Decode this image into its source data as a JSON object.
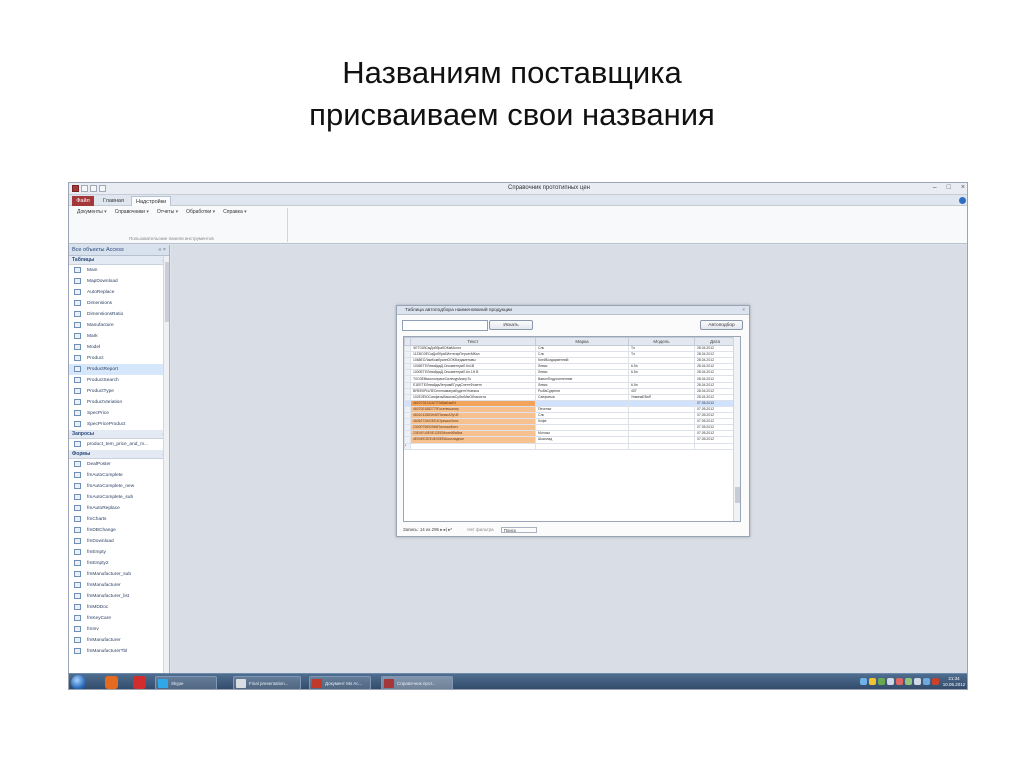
{
  "slide": {
    "title_line1": "Названиям поставщика",
    "title_line2": "присваиваем свои названия"
  },
  "window": {
    "title": "Справочник прототипных цен"
  },
  "ribbon": {
    "tabs": [
      "Файл",
      "Главная",
      "Надстройки"
    ],
    "menus": [
      "Документы",
      "Справочники",
      "Отчеты",
      "Обработки",
      "Справка"
    ],
    "group_label": "Пользовательские панели инструментов"
  },
  "nav": {
    "header": "Все объекты Access",
    "tables_header": "Таблицы",
    "tables": [
      "Main",
      "MapDownload",
      "AutoReplace",
      "Dimensions",
      "DimensionsRatio",
      "Manufacture",
      "Mark",
      "Model",
      "Product",
      "ProductReport",
      "ProductSearch",
      "ProductType",
      "ProductVariation",
      "SpecPrice",
      "SpecPriceProduct"
    ],
    "queries_header": "Запросы",
    "queries": [
      "product_tem_price_and_m..."
    ],
    "forms_header": "Формы",
    "forms": [
      "DealPoster",
      "fmAutoComplete",
      "fmAutoComplete_new",
      "fmAutoComplete_sub",
      "fmAutoReplace",
      "fmCharts",
      "fmDBChange",
      "fmDownload",
      "fmEmpty",
      "fmEmpty2",
      "fmManufacturer_sub",
      "fmManufacturer",
      "fmManufacturer_list",
      "fmMDDoc",
      "fmKeyCare",
      "fmInv",
      "fmManufacturer",
      "fmManufacturerTbl"
    ]
  },
  "form": {
    "title": "Таблица автоподбора наименований продукции",
    "find_button": "Искать",
    "autoselect_button": "Автоподбор",
    "columns": [
      "Текст",
      "Марка",
      "Модель",
      "Дата"
    ],
    "rows": [
      {
        "text": "ЧЕТ01ВСмДоббрабОКмМолот",
        "mark": "Слк",
        "model": "Тл",
        "date": "28.04.2012"
      },
      {
        "text": "1123ЮЗЕСмДоббраБИнтегарПерсатМКал",
        "mark": "Слк",
        "model": "Тл",
        "date": "28.04.2012"
      },
      {
        "text": "1068ЕОЛамКомбраннООКбогдаменовы",
        "mark": "КлейБогдарменний",
        "model": "",
        "date": "28.04.2012"
      },
      {
        "text": "1006ЕТЕЛевайдаД.ОнсаветнумЛ.6л1В",
        "mark": "Левис",
        "model": "6.5н",
        "date": "28.04.2012"
      },
      {
        "text": "1000ЕТЕЛевайдаД.ОнсаветнумЛ.6л.1Н.В",
        "mark": "Левис",
        "model": "6.5н",
        "date": "28.04.2012"
      },
      {
        "text": "Т0ОЗЕВмоснопрасеСилекурАнигрТо",
        "mark": "ВаволПодусопленние",
        "model": "",
        "date": "28.04.2012"
      },
      {
        "text": "Е1ЕЕТЕЛевайдаЛетрамЕГуодСлентФоаетн",
        "mark": "Левис",
        "model": "6.5н",
        "date": "28.04.2012"
      },
      {
        "text": "ВЯЕЕКРЫЛЕСеплнаматраБудентУнаекса",
        "mark": "РыбаСуденни",
        "model": "40Т",
        "date": "28.04.2012"
      },
      {
        "text": "102ЕЗЕЮСапфатыВасиовСубатМмОблагиста",
        "mark": "Сапфатыа",
        "model": "УнвинаЕВаП",
        "date": "28.04.2012"
      },
      {
        "text": "4607078741677ПАВаЕакЕ4",
        "mark": "",
        "model": "",
        "date": "07.05.2012"
      },
      {
        "text": "4607001882779Госенешанир",
        "mark": "Печенье",
        "model": "",
        "date": "07.05.2012"
      },
      {
        "text": "4601012883Н4ЕПанасАЗуЧЕ",
        "mark": "Слк",
        "model": "",
        "date": "07.05.2012"
      },
      {
        "text": "4606272602ЕЕ4ОрешкиЧипс",
        "mark": "Кофе",
        "model": "",
        "date": "07.05.2012"
      },
      {
        "text": "2300079692966ПалочкиБитч",
        "mark": "",
        "model": "",
        "date": "07.05.2012"
      },
      {
        "text": "23ЕЧЕЧ0Е0Е12ЕЕМолейбабиа",
        "mark": "Молоко",
        "model": "",
        "date": "07.05.2012"
      },
      {
        "text": "4Е00ЕЕ2ЕЕ4Е00ЕЕШоколадное",
        "mark": "Шоколад",
        "model": "",
        "date": "07.05.2012"
      }
    ],
    "record_nav": "Запись: 14 из 295",
    "filter_label": "Нет фильтра",
    "search_label": "Поиск"
  },
  "taskbar": {
    "tasks": [
      "Skype",
      "Final presentation...",
      "Документ Ms Ac...",
      "Справочник прот..."
    ],
    "clock_time": "21:34",
    "clock_date": "10.05.2012"
  },
  "colors": {
    "access_accent": "#a4373a",
    "orange_highlight": "#f7c08f",
    "selected_row": "#cfe2ff"
  }
}
